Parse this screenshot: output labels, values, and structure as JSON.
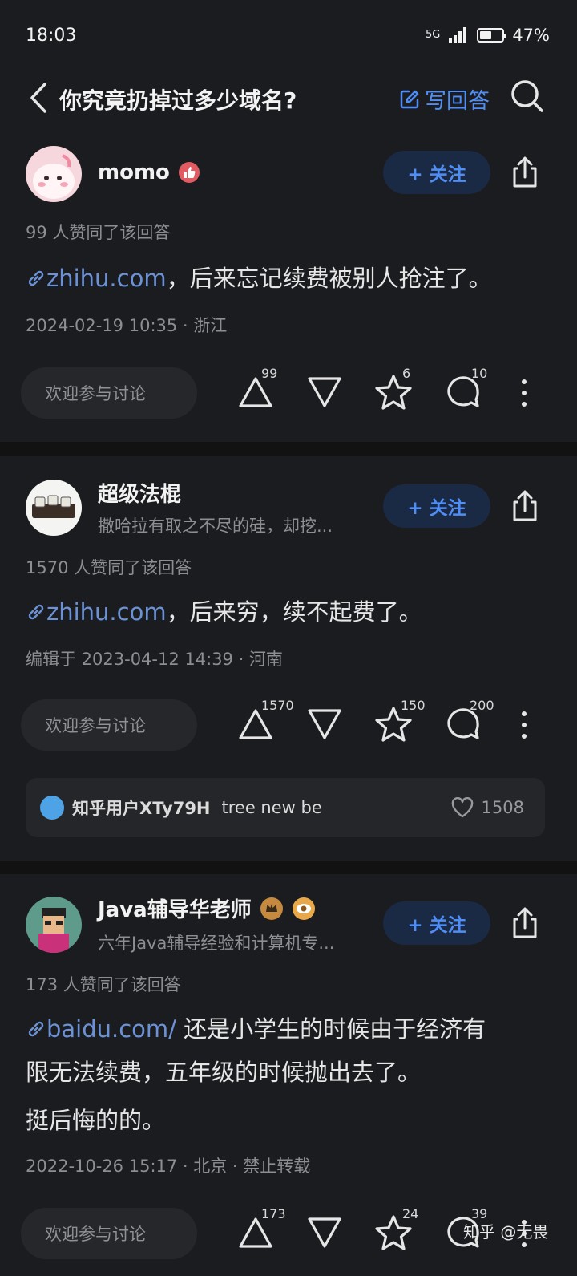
{
  "status_bar": {
    "time": "18:03",
    "network": "5G",
    "battery": "47%"
  },
  "nav": {
    "title": "你究竟扔掉过多少域名?",
    "write_answer": "写回答"
  },
  "answers": [
    {
      "author": "momo",
      "bio": "",
      "follow": "+ 关注",
      "votes_line": "99 人赞同了该回答",
      "link": "zhihu.com",
      "text": "，后来忘记续费被别人抢注了。",
      "meta": "2024-02-19 10:35 · 浙江",
      "comment_placeholder": "欢迎参与讨论",
      "upvotes": "99",
      "favorites": "6",
      "comments": "10"
    },
    {
      "author": "超级法棍",
      "bio": "撒哈拉有取之不尽的硅，却挖...",
      "follow": "+ 关注",
      "votes_line": "1570 人赞同了该回答",
      "link": "zhihu.com",
      "text": "，后来穷，续不起费了。",
      "meta": "编辑于 2023-04-12 14:39 · 河南",
      "comment_placeholder": "欢迎参与讨论",
      "upvotes": "1570",
      "favorites": "150",
      "comments": "200",
      "hot_comment": {
        "user": "知乎用户XTy79H",
        "text": "tree new be",
        "likes": "1508"
      }
    },
    {
      "author": "Java辅导华老师",
      "bio": "六年Java辅导经验和计算机专...",
      "follow": "+ 关注",
      "votes_line": "173 人赞同了该回答",
      "link": "baidu.com/",
      "text_line1": " 还是小学生的时候由于经济有",
      "text_line2": "限无法续费，五年级的时候抛出去了。",
      "text_line3": "挺后悔的的。",
      "meta": "2022-10-26 15:17 · 北京 · 禁止转载",
      "comment_placeholder": "欢迎参与讨论",
      "upvotes": "173",
      "favorites": "24",
      "comments": "39"
    }
  ],
  "watermark": "知乎 @无畏"
}
